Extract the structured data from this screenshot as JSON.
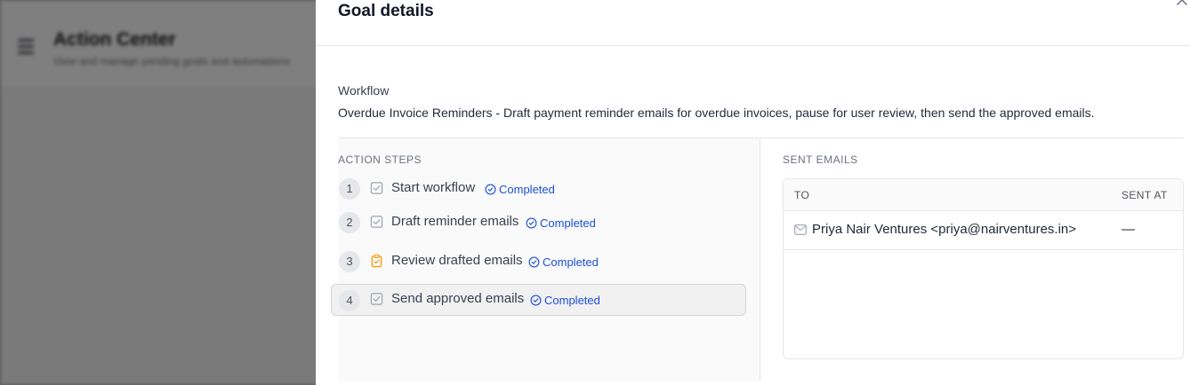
{
  "background": {
    "title": "Action Center",
    "subtitle": "View and manage pending goals and automations"
  },
  "panel": {
    "title": "Goal details",
    "close_icon": "close-icon"
  },
  "workflow": {
    "label": "Workflow",
    "description": "Overdue Invoice Reminders - Draft payment reminder emails for overdue invoices, pause for user review, then send the approved emails."
  },
  "action_steps": {
    "heading": "ACTION STEPS",
    "steps": [
      {
        "number": "1",
        "label": "Start workflow",
        "status": "Completed",
        "icon": "checkbox-icon",
        "selected": false
      },
      {
        "number": "2",
        "label": "Draft reminder emails",
        "status": "Completed",
        "icon": "checkbox-icon",
        "selected": false
      },
      {
        "number": "3",
        "label": "Review drafted emails",
        "status": "Completed",
        "icon": "clipboard-check-icon",
        "selected": false
      },
      {
        "number": "4",
        "label": "Send approved emails",
        "status": "Completed",
        "icon": "checkbox-icon",
        "selected": true
      }
    ]
  },
  "sent_emails": {
    "heading": "SENT EMAILS",
    "columns": [
      "TO",
      "SENT AT"
    ],
    "rows": [
      {
        "to": "Priya Nair Ventures <priya@nairventures.in>",
        "sent_at": "—"
      }
    ]
  },
  "colors": {
    "accent": "#1d4ed8",
    "review_icon": "#f59e0b",
    "overlay": "#000000"
  }
}
